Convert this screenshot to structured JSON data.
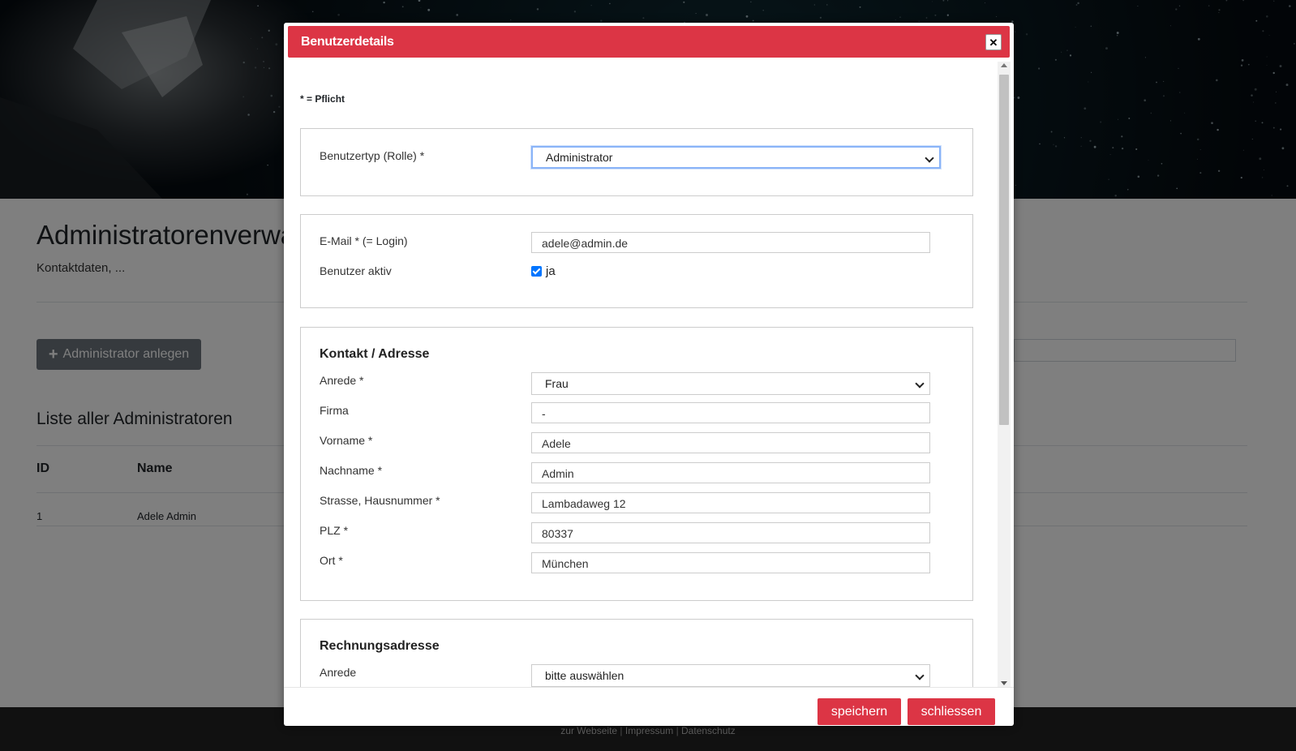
{
  "page": {
    "title": "Administratorenverwaltung",
    "subtitle": "Kontaktdaten, ...",
    "add_button_label": "Administrator anlegen",
    "list_title": "Liste aller Administratoren",
    "table": {
      "columns": [
        "ID",
        "Name"
      ],
      "rows": [
        {
          "id": "1",
          "name": "Adele Admin"
        }
      ]
    },
    "footer_links": [
      "zur Webseite",
      "Impressum",
      "Datenschutz"
    ]
  },
  "modal": {
    "title": "Benutzerdetails",
    "required_note": "* = Pflicht",
    "role": {
      "label": "Benutzertyp (Rolle) *",
      "value": "Administrator"
    },
    "account": {
      "email_label": "E-Mail * (= Login)",
      "email_value": "adele@admin.de",
      "active_label": "Benutzer aktiv",
      "active_checked": true,
      "active_option": "ja"
    },
    "contact": {
      "heading": "Kontakt / Adresse",
      "salutation_label": "Anrede *",
      "salutation_value": "Frau",
      "company_label": "Firma",
      "company_value": "-",
      "firstname_label": "Vorname *",
      "firstname_value": "Adele",
      "lastname_label": "Nachname *",
      "lastname_value": "Admin",
      "street_label": "Strasse, Hausnummer *",
      "street_value": "Lambadaweg 12",
      "zip_label": "PLZ *",
      "zip_value": "80337",
      "city_label": "Ort *",
      "city_value": "München"
    },
    "billing": {
      "heading": "Rechnungsadresse",
      "salutation_label": "Anrede",
      "salutation_value": "bitte auswählen"
    },
    "save_label": "speichern",
    "close_label": "schliessen"
  },
  "colors": {
    "accent": "#dc3545",
    "secondary": "#6c757d",
    "checkbox": "#0075ff",
    "footer": "#222222"
  }
}
